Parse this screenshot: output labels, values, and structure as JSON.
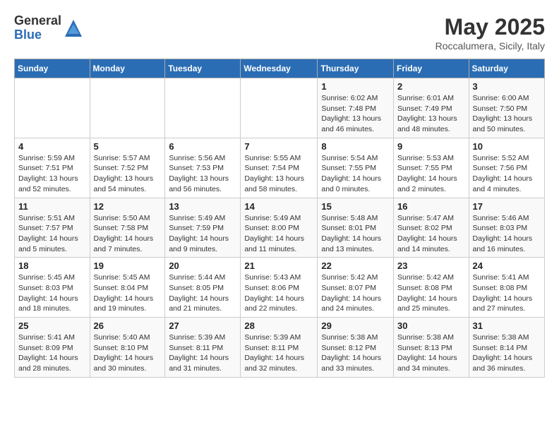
{
  "logo": {
    "general": "General",
    "blue": "Blue"
  },
  "title": "May 2025",
  "location": "Roccalumera, Sicily, Italy",
  "days_of_week": [
    "Sunday",
    "Monday",
    "Tuesday",
    "Wednesday",
    "Thursday",
    "Friday",
    "Saturday"
  ],
  "weeks": [
    [
      {
        "day": "",
        "info": ""
      },
      {
        "day": "",
        "info": ""
      },
      {
        "day": "",
        "info": ""
      },
      {
        "day": "",
        "info": ""
      },
      {
        "day": "1",
        "info": "Sunrise: 6:02 AM\nSunset: 7:48 PM\nDaylight: 13 hours\nand 46 minutes."
      },
      {
        "day": "2",
        "info": "Sunrise: 6:01 AM\nSunset: 7:49 PM\nDaylight: 13 hours\nand 48 minutes."
      },
      {
        "day": "3",
        "info": "Sunrise: 6:00 AM\nSunset: 7:50 PM\nDaylight: 13 hours\nand 50 minutes."
      }
    ],
    [
      {
        "day": "4",
        "info": "Sunrise: 5:59 AM\nSunset: 7:51 PM\nDaylight: 13 hours\nand 52 minutes."
      },
      {
        "day": "5",
        "info": "Sunrise: 5:57 AM\nSunset: 7:52 PM\nDaylight: 13 hours\nand 54 minutes."
      },
      {
        "day": "6",
        "info": "Sunrise: 5:56 AM\nSunset: 7:53 PM\nDaylight: 13 hours\nand 56 minutes."
      },
      {
        "day": "7",
        "info": "Sunrise: 5:55 AM\nSunset: 7:54 PM\nDaylight: 13 hours\nand 58 minutes."
      },
      {
        "day": "8",
        "info": "Sunrise: 5:54 AM\nSunset: 7:55 PM\nDaylight: 14 hours\nand 0 minutes."
      },
      {
        "day": "9",
        "info": "Sunrise: 5:53 AM\nSunset: 7:55 PM\nDaylight: 14 hours\nand 2 minutes."
      },
      {
        "day": "10",
        "info": "Sunrise: 5:52 AM\nSunset: 7:56 PM\nDaylight: 14 hours\nand 4 minutes."
      }
    ],
    [
      {
        "day": "11",
        "info": "Sunrise: 5:51 AM\nSunset: 7:57 PM\nDaylight: 14 hours\nand 5 minutes."
      },
      {
        "day": "12",
        "info": "Sunrise: 5:50 AM\nSunset: 7:58 PM\nDaylight: 14 hours\nand 7 minutes."
      },
      {
        "day": "13",
        "info": "Sunrise: 5:49 AM\nSunset: 7:59 PM\nDaylight: 14 hours\nand 9 minutes."
      },
      {
        "day": "14",
        "info": "Sunrise: 5:49 AM\nSunset: 8:00 PM\nDaylight: 14 hours\nand 11 minutes."
      },
      {
        "day": "15",
        "info": "Sunrise: 5:48 AM\nSunset: 8:01 PM\nDaylight: 14 hours\nand 13 minutes."
      },
      {
        "day": "16",
        "info": "Sunrise: 5:47 AM\nSunset: 8:02 PM\nDaylight: 14 hours\nand 14 minutes."
      },
      {
        "day": "17",
        "info": "Sunrise: 5:46 AM\nSunset: 8:03 PM\nDaylight: 14 hours\nand 16 minutes."
      }
    ],
    [
      {
        "day": "18",
        "info": "Sunrise: 5:45 AM\nSunset: 8:03 PM\nDaylight: 14 hours\nand 18 minutes."
      },
      {
        "day": "19",
        "info": "Sunrise: 5:45 AM\nSunset: 8:04 PM\nDaylight: 14 hours\nand 19 minutes."
      },
      {
        "day": "20",
        "info": "Sunrise: 5:44 AM\nSunset: 8:05 PM\nDaylight: 14 hours\nand 21 minutes."
      },
      {
        "day": "21",
        "info": "Sunrise: 5:43 AM\nSunset: 8:06 PM\nDaylight: 14 hours\nand 22 minutes."
      },
      {
        "day": "22",
        "info": "Sunrise: 5:42 AM\nSunset: 8:07 PM\nDaylight: 14 hours\nand 24 minutes."
      },
      {
        "day": "23",
        "info": "Sunrise: 5:42 AM\nSunset: 8:08 PM\nDaylight: 14 hours\nand 25 minutes."
      },
      {
        "day": "24",
        "info": "Sunrise: 5:41 AM\nSunset: 8:08 PM\nDaylight: 14 hours\nand 27 minutes."
      }
    ],
    [
      {
        "day": "25",
        "info": "Sunrise: 5:41 AM\nSunset: 8:09 PM\nDaylight: 14 hours\nand 28 minutes."
      },
      {
        "day": "26",
        "info": "Sunrise: 5:40 AM\nSunset: 8:10 PM\nDaylight: 14 hours\nand 30 minutes."
      },
      {
        "day": "27",
        "info": "Sunrise: 5:39 AM\nSunset: 8:11 PM\nDaylight: 14 hours\nand 31 minutes."
      },
      {
        "day": "28",
        "info": "Sunrise: 5:39 AM\nSunset: 8:11 PM\nDaylight: 14 hours\nand 32 minutes."
      },
      {
        "day": "29",
        "info": "Sunrise: 5:38 AM\nSunset: 8:12 PM\nDaylight: 14 hours\nand 33 minutes."
      },
      {
        "day": "30",
        "info": "Sunrise: 5:38 AM\nSunset: 8:13 PM\nDaylight: 14 hours\nand 34 minutes."
      },
      {
        "day": "31",
        "info": "Sunrise: 5:38 AM\nSunset: 8:14 PM\nDaylight: 14 hours\nand 36 minutes."
      }
    ]
  ]
}
